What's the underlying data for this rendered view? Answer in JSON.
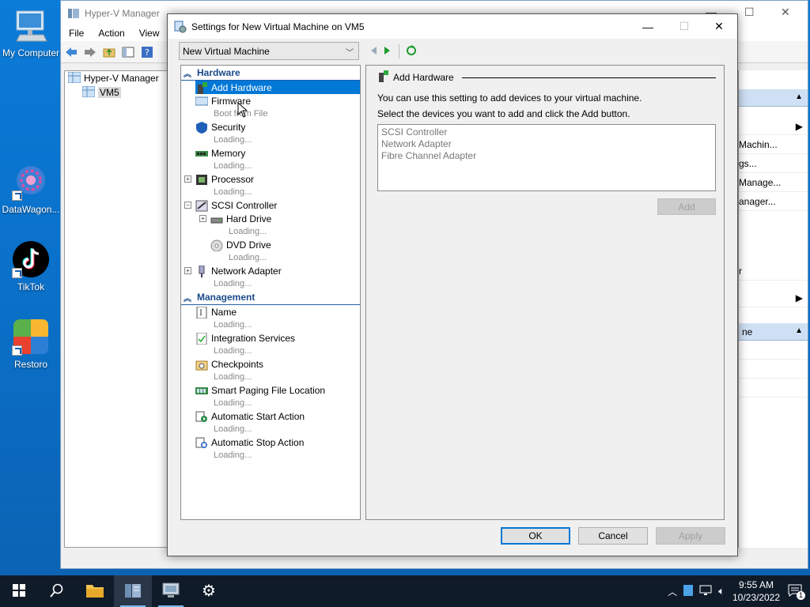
{
  "desktop": {
    "icons": [
      {
        "label": "My Computer"
      },
      {
        "label": "DataWagon..."
      },
      {
        "label": "TikTok"
      },
      {
        "label": "Restoro"
      }
    ]
  },
  "hyperv": {
    "title": "Hyper-V Manager",
    "menu": [
      "File",
      "Action",
      "View"
    ],
    "tree": {
      "root": "Hyper-V Manager",
      "host": "VM5"
    },
    "actions": {
      "items": [
        "Machin...",
        "gs...",
        "Manage...",
        "anager...",
        "r"
      ],
      "lower_head": "ne"
    }
  },
  "dialog": {
    "title": "Settings for New Virtual Machine on VM5",
    "vm_select": "New Virtual Machine",
    "sections": {
      "hardware": "Hardware",
      "management": "Management"
    },
    "hardware_items": [
      {
        "name": "Add Hardware",
        "sub": ""
      },
      {
        "name": "Firmware",
        "sub": "Boot from File"
      },
      {
        "name": "Security",
        "sub": "Loading..."
      },
      {
        "name": "Memory",
        "sub": "Loading..."
      },
      {
        "name": "Processor",
        "sub": "Loading..."
      },
      {
        "name": "SCSI Controller",
        "sub": ""
      },
      {
        "name": "Hard Drive",
        "sub": "Loading..."
      },
      {
        "name": "DVD Drive",
        "sub": "Loading..."
      },
      {
        "name": "Network Adapter",
        "sub": "Loading..."
      }
    ],
    "management_items": [
      {
        "name": "Name",
        "sub": "Loading..."
      },
      {
        "name": "Integration Services",
        "sub": "Loading..."
      },
      {
        "name": "Checkpoints",
        "sub": "Loading..."
      },
      {
        "name": "Smart Paging File Location",
        "sub": "Loading..."
      },
      {
        "name": "Automatic Start Action",
        "sub": "Loading..."
      },
      {
        "name": "Automatic Stop Action",
        "sub": "Loading..."
      }
    ],
    "panel": {
      "heading": "Add Hardware",
      "line1": "You can use this setting to add devices to your virtual machine.",
      "line2": "Select the devices you want to add and click the Add button.",
      "devices": [
        "SCSI Controller",
        "Network Adapter",
        "Fibre Channel Adapter"
      ],
      "add_label": "Add"
    },
    "buttons": {
      "ok": "OK",
      "cancel": "Cancel",
      "apply": "Apply"
    }
  },
  "taskbar": {
    "time": "9:55 AM",
    "date": "10/23/2022",
    "notification_count": "1"
  },
  "colors": {
    "accent": "#0078d7",
    "desktop": "#0a78d4",
    "taskbar": "#101b2a"
  }
}
